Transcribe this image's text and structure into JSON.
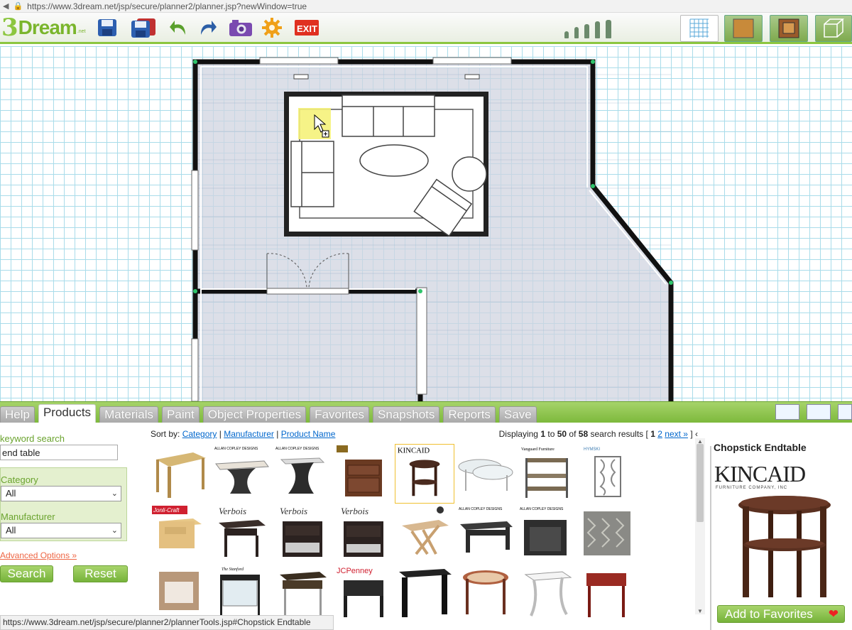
{
  "browser": {
    "url": "https://www.3dream.net/jsp/secure/planner2/planner.jsp?newWindow=true"
  },
  "logo": {
    "three": "3",
    "word": "Dream",
    "sub": ".net"
  },
  "toolbar": {
    "buttons": [
      {
        "name": "save-icon"
      },
      {
        "name": "save-as-icon"
      },
      {
        "name": "undo-icon"
      },
      {
        "name": "redo-icon"
      },
      {
        "name": "camera-icon"
      },
      {
        "name": "settings-gear-icon"
      },
      {
        "name": "exit-icon"
      }
    ],
    "exit_label": "EXIT",
    "view_modes": [
      "2d-grid-view",
      "floor-view",
      "room-view",
      "3d-view"
    ]
  },
  "tabs": [
    {
      "label": "Help",
      "active": false
    },
    {
      "label": "Products",
      "active": true
    },
    {
      "label": "Materials",
      "active": false
    },
    {
      "label": "Paint",
      "active": false
    },
    {
      "label": "Object Properties",
      "active": false
    },
    {
      "label": "Favorites",
      "active": false
    },
    {
      "label": "Snapshots",
      "active": false
    },
    {
      "label": "Reports",
      "active": false
    },
    {
      "label": "Save",
      "active": false
    }
  ],
  "search": {
    "keyword_label": "keyword search",
    "keyword_value": "end table",
    "category_label": "Category",
    "category_value": "All",
    "manufacturer_label": "Manufacturer",
    "manufacturer_value": "All",
    "advanced_link": "Advanced Options »",
    "search_button": "Search",
    "reset_button": "Reset"
  },
  "results": {
    "sort_by_label": "Sort by:",
    "sort_options": [
      "Category",
      "Manufacturer",
      "Product Name"
    ],
    "display_prefix": "Displaying",
    "display_from": "1",
    "display_to_word": "to",
    "display_to": "50",
    "display_of_word": "of",
    "display_total": "58",
    "display_suffix": "search results [",
    "page_current": "1",
    "page_2": "2",
    "next_link": "next »",
    "page_close": "]",
    "brand_labels": {
      "allan": "ALLAN COPLEY DESIGNS",
      "kincaid": "KINCAID",
      "vanguard": "Vanguard Furniture",
      "hymsky": "HYMSKI",
      "jonli": "Jonli-Craft",
      "verbois": "Verbois",
      "jcpenney": "JCPenney"
    }
  },
  "detail": {
    "title": "Chopstick Endtable",
    "brand": "KINCAID",
    "brand_sub": "FURNITURE COMPANY, INC",
    "favorites_button": "Add to Favorites",
    "heart": "❤"
  },
  "status_bar": "https://www.3dream.net/jsp/secure/planner2/plannerTools.jsp#Chopstick Endtable",
  "colors": {
    "accent_green": "#8cc63f",
    "grid_blue": "#a9dcea",
    "room_fill": "#d0d4e0",
    "wall": "#111111"
  }
}
